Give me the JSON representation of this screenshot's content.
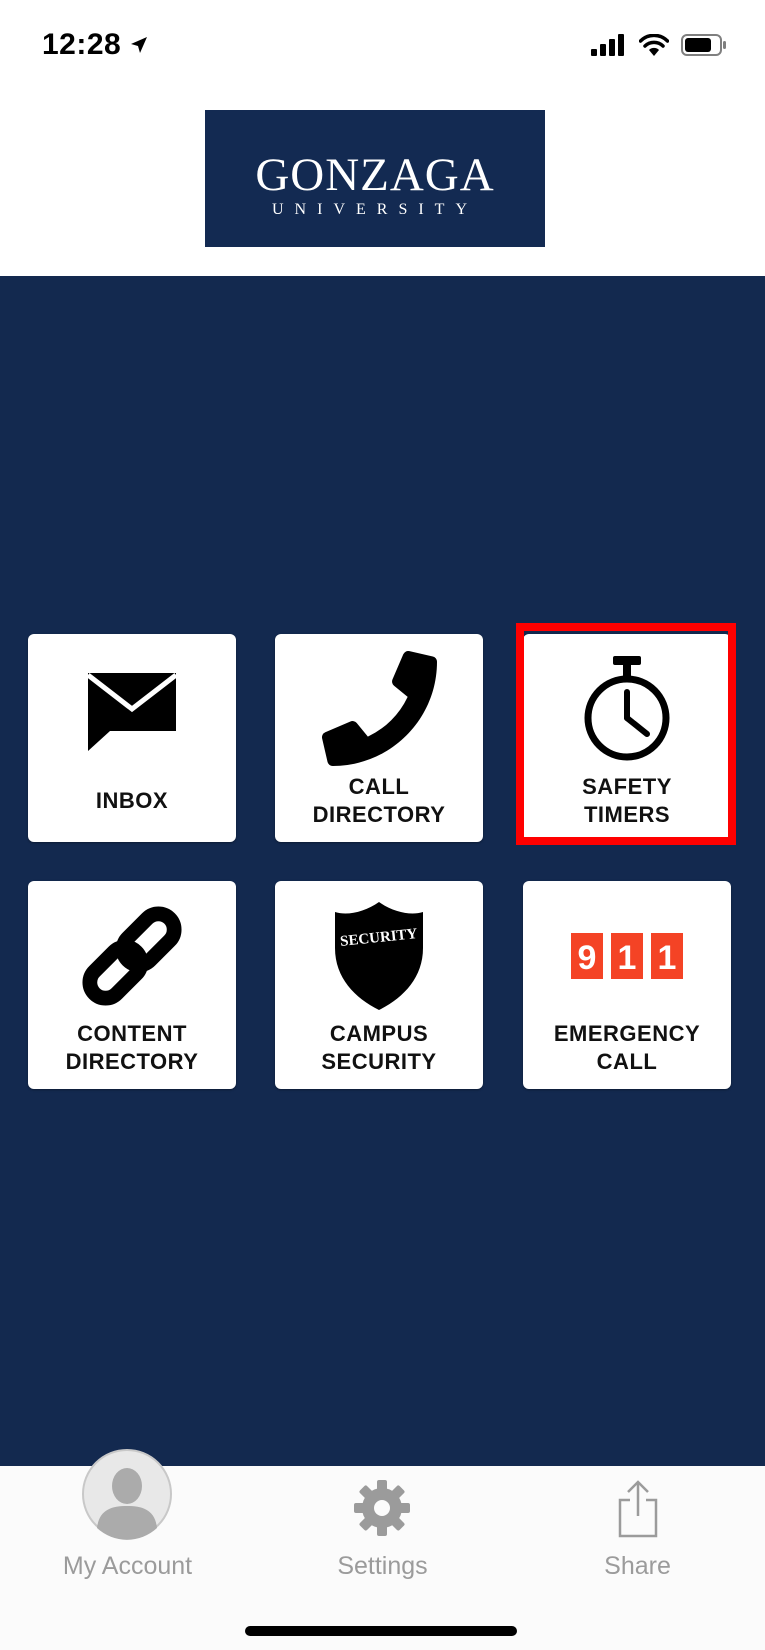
{
  "status": {
    "time": "12:28"
  },
  "header": {
    "logo_main": "GONZAGA",
    "logo_sub": "UNIVERSITY"
  },
  "tiles": [
    {
      "id": "inbox",
      "icon": "mail-icon",
      "label_lines": [
        "INBOX"
      ]
    },
    {
      "id": "call-directory",
      "icon": "phone-icon",
      "label_lines": [
        "CALL",
        "DIRECTORY"
      ]
    },
    {
      "id": "safety-timers",
      "icon": "stopwatch-icon",
      "label_lines": [
        "SAFETY",
        "TIMERS"
      ]
    },
    {
      "id": "content-directory",
      "icon": "link-icon",
      "label_lines": [
        "CONTENT",
        "DIRECTORY"
      ]
    },
    {
      "id": "campus-security",
      "icon": "security-badge-icon",
      "label_lines": [
        "CAMPUS",
        "SECURITY"
      ],
      "badge_text": "SECURITY"
    },
    {
      "id": "emergency-call",
      "icon": "emergency-911-icon",
      "label_lines": [
        "EMERGENCY",
        "CALL"
      ],
      "digits": [
        "9",
        "1",
        "1"
      ]
    }
  ],
  "tabbar": {
    "items": [
      {
        "label": "My Account",
        "icon": "avatar-icon"
      },
      {
        "label": "Settings",
        "icon": "gear-icon"
      },
      {
        "label": "Share",
        "icon": "share-icon"
      }
    ]
  },
  "colors": {
    "navy": "#13294f",
    "highlight": "#ff0000",
    "emergency_red": "#f44325",
    "tab_gray": "#9b9b9b"
  }
}
